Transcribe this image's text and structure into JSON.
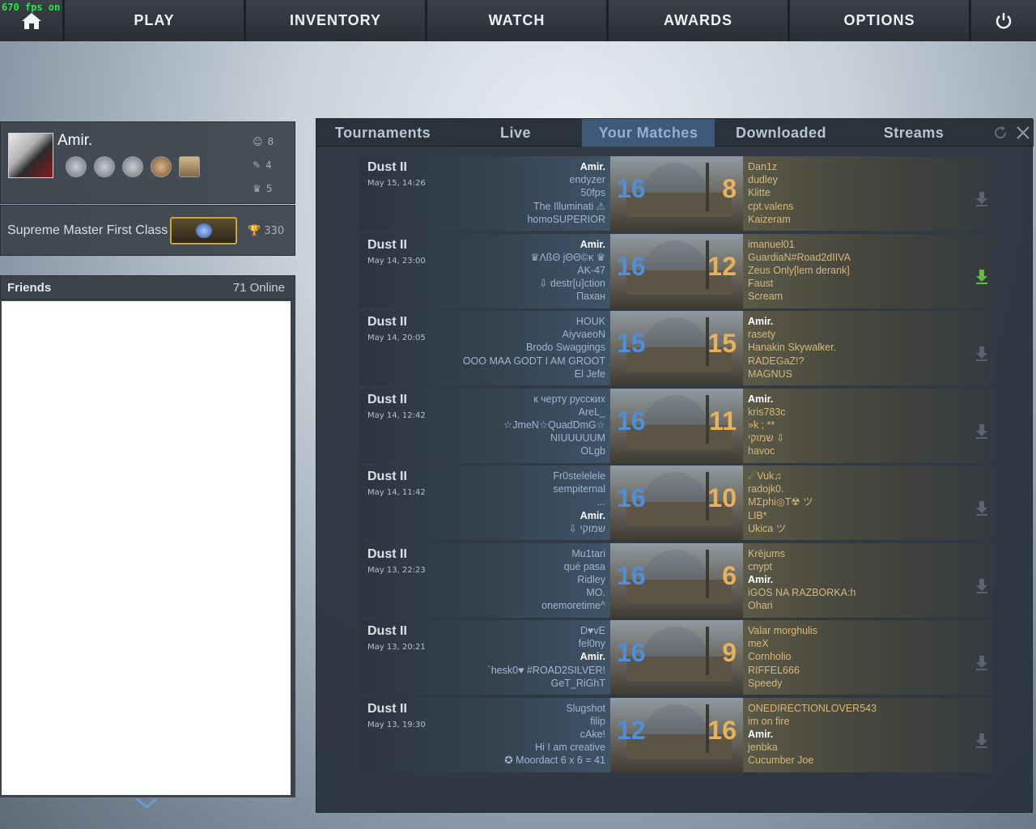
{
  "fps": "670 fps on",
  "nav": {
    "items": [
      {
        "label": "PLAY"
      },
      {
        "label": "INVENTORY"
      },
      {
        "label": "WATCH"
      },
      {
        "label": "AWARDS"
      },
      {
        "label": "OPTIONS"
      }
    ]
  },
  "profile": {
    "name": "Amir.",
    "stats": {
      "friendly": "8",
      "teacher": "4",
      "leader": "5"
    },
    "rank": "Supreme Master First Class",
    "score": "330"
  },
  "friends": {
    "title": "Friends",
    "online": "71 Online"
  },
  "tabs": [
    "Tournaments",
    "Live",
    "Your Matches",
    "Downloaded",
    "Streams"
  ],
  "matches": [
    {
      "map": "Dust II",
      "date": "May 15, 14:26",
      "score_ct": "16",
      "score_t": "8",
      "ct": [
        "Amir.",
        "endyzer",
        "50fps",
        "The Illuminati ⚠",
        "homoSUPERIOR"
      ],
      "t": [
        "Dan1z",
        "dudley",
        "Klitte",
        "cpt.valens",
        "Kaizeram"
      ]
    },
    {
      "map": "Dust II",
      "date": "May 14, 23:00",
      "score_ct": "16",
      "score_t": "12",
      "ct": [
        "Amir.",
        "♛ΛßΘ jΘΘ©κ ♛",
        "AK-47",
        "⇩ destr[u]ction",
        "Пахан"
      ],
      "t": [
        "imanuel01",
        "GuardiaN#Road2dIIVA",
        "Zeus Only[lem derank]",
        "Faust",
        "Scream"
      ]
    },
    {
      "map": "Dust II",
      "date": "May 14, 20:05",
      "score_ct": "15",
      "score_t": "15",
      "ct": [
        "HOUK",
        "AiyvaeoN",
        "Brodo Swaggings",
        "OOO MAA GODT I AM GROOT",
        "El Jefe"
      ],
      "t": [
        "Amir.",
        "rasety",
        "Hanakin Skywalker.",
        "RADEGaZ!?",
        "MAGNUS"
      ]
    },
    {
      "map": "Dust II",
      "date": "May 14, 12:42",
      "score_ct": "16",
      "score_t": "11",
      "ct": [
        "к черту русских",
        "AreL_",
        "☆JmeN☆QuadDmG☆",
        "NIUUUUUM",
        "OLgb"
      ],
      "t": [
        "Amir.",
        "kris783c",
        "»k ; **",
        "שמוקי ⇩",
        "havoc"
      ]
    },
    {
      "map": "Dust II",
      "date": "May 14, 11:42",
      "score_ct": "16",
      "score_t": "10",
      "ct": [
        "Fr0stelelele",
        "sempiternal",
        "...",
        "Amir.",
        "⇩ שמוקי"
      ],
      "t": [
        "☄Vuk♫",
        "radojk0.",
        "MΣphi◎T☢ ツ",
        "LIB*",
        "Ukica ツ"
      ]
    },
    {
      "map": "Dust II",
      "date": "May 13, 22:23",
      "score_ct": "16",
      "score_t": "6",
      "ct": [
        "Mu1tari",
        "qué pasa",
        "Ridley",
        "MO.",
        "onemoretime^"
      ],
      "t": [
        "Krējums",
        "cnypt",
        "Amir.",
        "iGOS NA RAZBORKA:h",
        "Ohari"
      ]
    },
    {
      "map": "Dust II",
      "date": "May 13, 20:21",
      "score_ct": "16",
      "score_t": "9",
      "ct": [
        "D♥vE",
        "fel0ny",
        "Amir.",
        "`hesk0♥ #ROAD2SILVER!",
        "GeT_RiGhT"
      ],
      "t": [
        "Valar morghulis",
        "meX",
        "Cornholio",
        "RIFFEL666",
        "Speedy"
      ]
    },
    {
      "map": "Dust II",
      "date": "May 13, 19:30",
      "score_ct": "12",
      "score_t": "16",
      "ct": [
        "Slugshot",
        "filip",
        "cAke!",
        "Hi I am creative",
        "✪ Moordact 6 x 6 = 41"
      ],
      "t": [
        "ONEDIRECTIONLOVER543",
        "im on fire",
        "Amir.",
        "jenbka",
        "Cucumber Joe"
      ]
    }
  ],
  "colors": {
    "ct_score": "#4d8fdc",
    "t_score": "#e7b25b",
    "active_tab": "#3f5a79",
    "download_ready": "#5fbf3a"
  }
}
